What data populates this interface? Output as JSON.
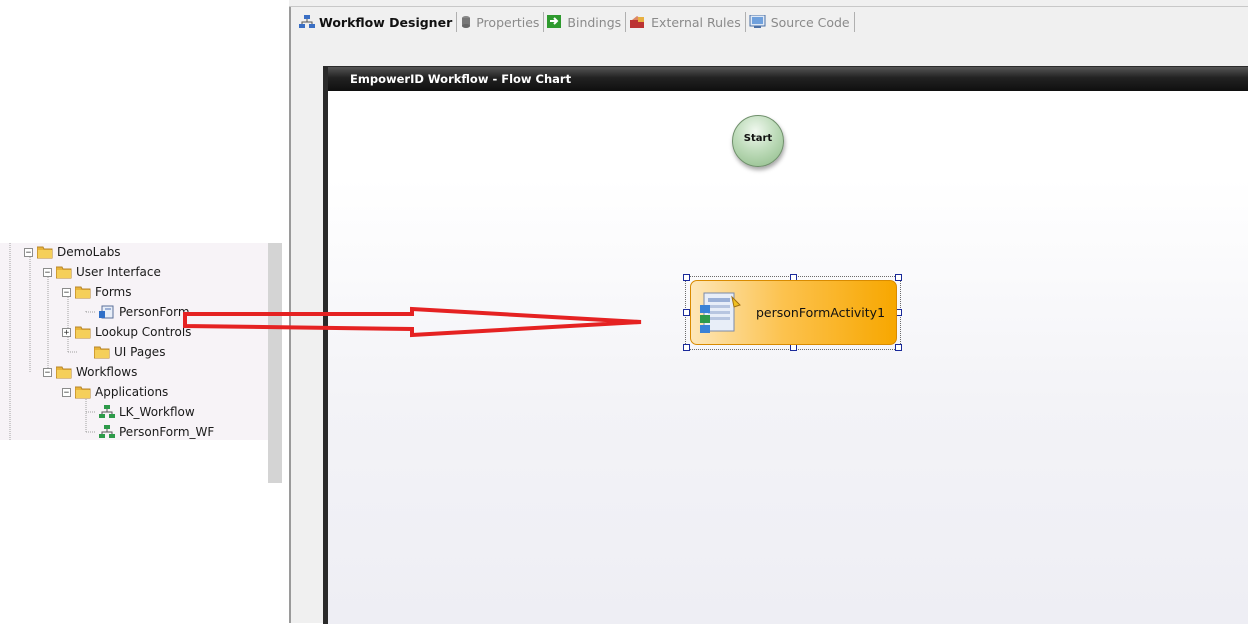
{
  "tree": {
    "items": [
      {
        "label": "DemoLabs",
        "expander": "−",
        "type": "folder"
      },
      {
        "label": "User Interface",
        "expander": "−",
        "type": "folder"
      },
      {
        "label": "Forms",
        "expander": "−",
        "type": "folder"
      },
      {
        "label": "PersonForm",
        "expander": "",
        "type": "form"
      },
      {
        "label": "Lookup Controls",
        "expander": "+",
        "type": "folder"
      },
      {
        "label": "UI Pages",
        "expander": "",
        "type": "folder"
      },
      {
        "label": "Workflows",
        "expander": "−",
        "type": "folder"
      },
      {
        "label": "Applications",
        "expander": "−",
        "type": "folder"
      },
      {
        "label": "LK_Workflow",
        "expander": "",
        "type": "workflow"
      },
      {
        "label": "PersonForm_WF",
        "expander": "",
        "type": "workflow"
      }
    ]
  },
  "tabs": [
    {
      "label": "Workflow Designer",
      "icon": "workflow-designer-icon",
      "active": true
    },
    {
      "label": "Properties",
      "icon": "properties-icon",
      "active": false
    },
    {
      "label": "Bindings",
      "icon": "bindings-icon",
      "active": false
    },
    {
      "label": "External Rules",
      "icon": "external-rules-icon",
      "active": false
    },
    {
      "label": "Source Code",
      "icon": "source-code-icon",
      "active": false
    }
  ],
  "canvas": {
    "title": "EmpowerID Workflow - Flow Chart",
    "start_label": "Start",
    "activity_label": "personFormActivity1"
  },
  "colors": {
    "arrow": "#e52222",
    "activity_accent": "#f7a700",
    "start_node": "#a8cfa2"
  }
}
